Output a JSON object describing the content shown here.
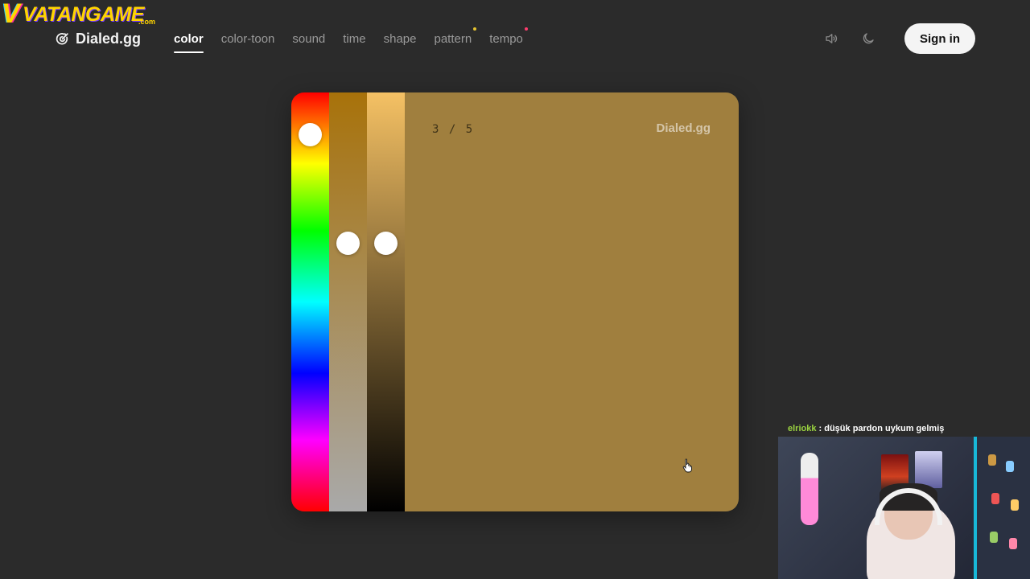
{
  "overlay": {
    "logo_initial": "V",
    "logo_text": "VATANGAME",
    "logo_domain": ".com"
  },
  "header": {
    "brand_name": "Dialed.gg",
    "tabs": [
      {
        "label": "color",
        "active": true
      },
      {
        "label": "color-toon"
      },
      {
        "label": "sound"
      },
      {
        "label": "time"
      },
      {
        "label": "shape"
      },
      {
        "label": "pattern",
        "dot_color": "#e6c430"
      },
      {
        "label": "tempo",
        "dot_color": "#ff3d6e"
      }
    ],
    "sign_in_label": "Sign in",
    "icons": [
      "volume-icon",
      "moon-icon"
    ]
  },
  "game": {
    "progress": "3 / 5",
    "watermark": "Dialed.gg",
    "target_color": "#a07f3e",
    "colors": {
      "hue_top": "#ff0000",
      "saturation_top": "#a8720a",
      "saturation_bottom": "#a9a9a9",
      "brightness_top": "#f5c164",
      "brightness_bottom": "#000000"
    },
    "sliders": {
      "hue": 0.1,
      "saturation": 0.36,
      "brightness": 0.36
    }
  },
  "stream": {
    "chat_user": "elriokk",
    "chat_message": " : düşük pardon uykum gelmiş"
  }
}
